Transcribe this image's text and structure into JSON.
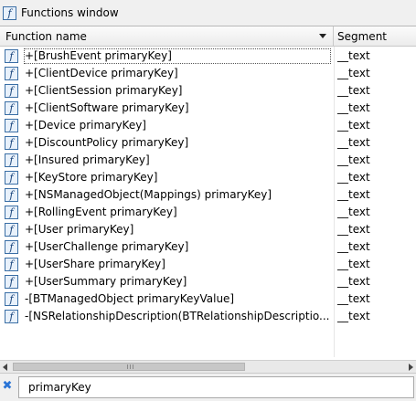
{
  "window": {
    "title": "Functions window",
    "icon": "function-icon",
    "icon_glyph": "f"
  },
  "table": {
    "columns": {
      "name": "Function name",
      "segment": "Segment"
    },
    "rows": [
      {
        "name": "+[BrushEvent primaryKey]",
        "segment": "__text"
      },
      {
        "name": "+[ClientDevice primaryKey]",
        "segment": "__text"
      },
      {
        "name": "+[ClientSession primaryKey]",
        "segment": "__text"
      },
      {
        "name": "+[ClientSoftware primaryKey]",
        "segment": "__text"
      },
      {
        "name": "+[Device primaryKey]",
        "segment": "__text"
      },
      {
        "name": "+[DiscountPolicy primaryKey]",
        "segment": "__text"
      },
      {
        "name": "+[Insured primaryKey]",
        "segment": "__text"
      },
      {
        "name": "+[KeyStore primaryKey]",
        "segment": "__text"
      },
      {
        "name": "+[NSManagedObject(Mappings) primaryKey]",
        "segment": "__text"
      },
      {
        "name": "+[RollingEvent primaryKey]",
        "segment": "__text"
      },
      {
        "name": "+[User primaryKey]",
        "segment": "__text"
      },
      {
        "name": "+[UserChallenge primaryKey]",
        "segment": "__text"
      },
      {
        "name": "+[UserShare primaryKey]",
        "segment": "__text"
      },
      {
        "name": "+[UserSummary primaryKey]",
        "segment": "__text"
      },
      {
        "name": "-[BTManagedObject primaryKeyValue]",
        "segment": "__text"
      },
      {
        "name": "-[NSRelationshipDescription(BTRelationshipDescriptio...",
        "segment": "__text"
      }
    ]
  },
  "filter": {
    "value": "primaryKey",
    "clear_icon": "clear-filter-icon"
  },
  "colors": {
    "icon_border": "#3a6ea5",
    "icon_fill": "#e8f1fb",
    "clear_icon": "#2a74d6"
  }
}
